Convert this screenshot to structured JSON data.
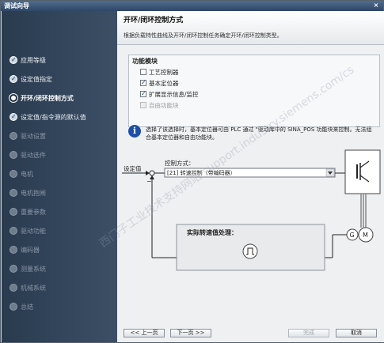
{
  "window": {
    "title": "调试向导",
    "close_symbol": "×"
  },
  "sidebar": {
    "steps": [
      {
        "label": "应用等级",
        "state": "done"
      },
      {
        "label": "设定值指定",
        "state": "done"
      },
      {
        "label": "开环/闭环控制方式",
        "state": "active"
      },
      {
        "label": "设定值/指令源的默认值",
        "state": "done"
      },
      {
        "label": "驱动设置",
        "state": "todo"
      },
      {
        "label": "驱动选件",
        "state": "todo"
      },
      {
        "label": "电机",
        "state": "todo"
      },
      {
        "label": "电机抱闸",
        "state": "todo"
      },
      {
        "label": "重要参数",
        "state": "todo"
      },
      {
        "label": "驱动功能",
        "state": "todo"
      },
      {
        "label": "编码器",
        "state": "todo"
      },
      {
        "label": "测量系统",
        "state": "todo"
      },
      {
        "label": "机械系统",
        "state": "todo"
      },
      {
        "label": "总结",
        "state": "todo"
      }
    ]
  },
  "header": {
    "title": "开环/闭环控制方式",
    "description": "根据负载特性曲线及开环/闭环控制任务确定开环/闭环控制类型。"
  },
  "function_modules": {
    "title": "功能模块",
    "items": [
      {
        "label": "工艺控制器",
        "checked": false,
        "disabled": false
      },
      {
        "label": "基本定位器",
        "checked": true,
        "disabled": false
      },
      {
        "label": "扩展显示信息/监控",
        "checked": true,
        "disabled": false
      },
      {
        "label": "自由功能块",
        "checked": false,
        "disabled": true
      }
    ]
  },
  "info": {
    "icon": "i",
    "text": "选择了该选择时，基本定位器可由 PLC 通过 \"驱动库中的 SINA_POS 功能块来控制。无法组合基本定位器和自由功能块。"
  },
  "diagram": {
    "setpoint_label": "设定值",
    "control_mode_label": "控制方式：",
    "control_mode_value": "[21] 转速控制（带编码器）",
    "minus_sign": "−",
    "actual_speed_title": "实际转速值处理：",
    "encoder_label": "G",
    "motor_label": "M"
  },
  "footer": {
    "prev": "<< 上一页",
    "next": "下一页 >>",
    "finish": "完成",
    "cancel": "取消"
  },
  "watermark": "西门子工业技术支持网站 support.industry.siemens.com/cs"
}
